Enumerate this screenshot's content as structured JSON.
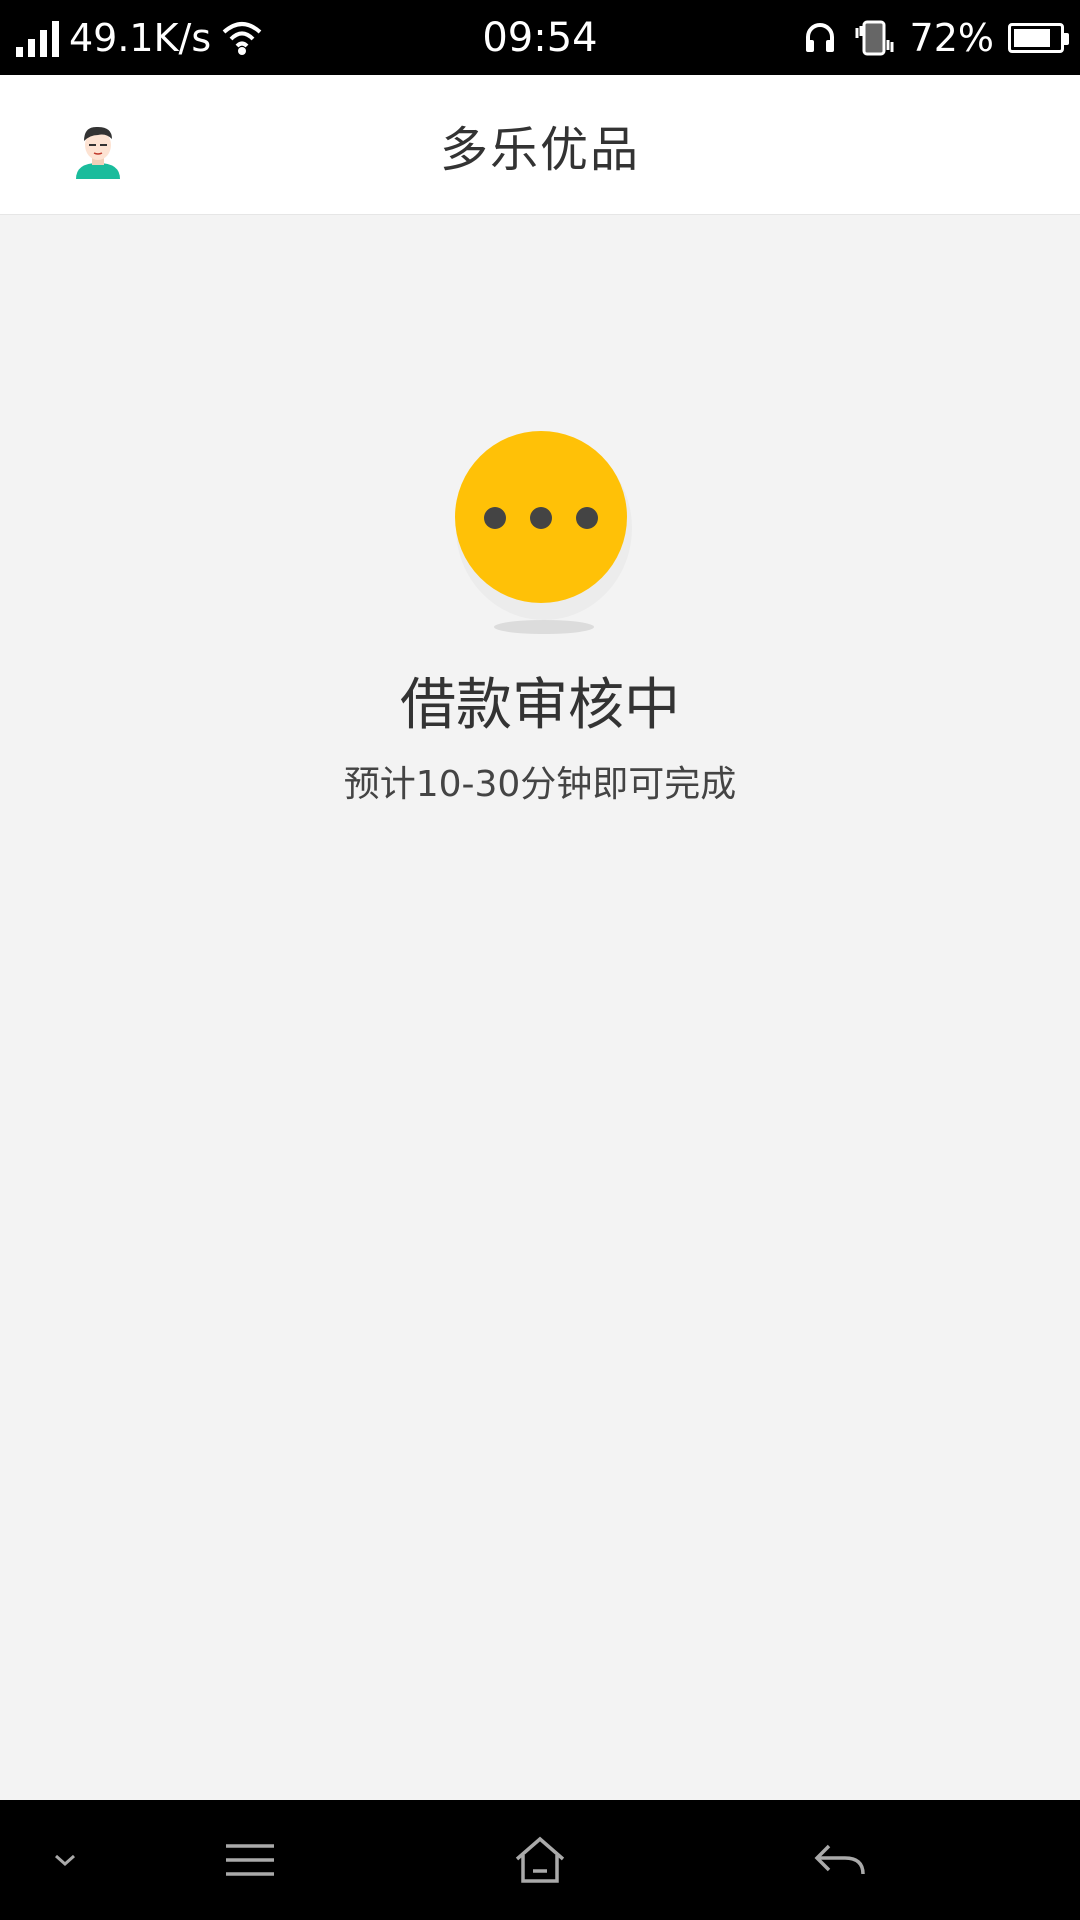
{
  "status_bar": {
    "network_speed": "49.1K/s",
    "time": "09:54",
    "battery_percent": "72%",
    "icons": [
      "signal-icon",
      "wifi-icon",
      "headset-icon",
      "vibrate-icon",
      "battery-icon"
    ]
  },
  "header": {
    "title": "多乐优品",
    "avatar_icon": "user-avatar-icon"
  },
  "status": {
    "icon": "pending-dots-icon",
    "title": "借款审核中",
    "subtitle": "预计10-30分钟即可完成",
    "accent_color": "#FFC107"
  },
  "nav_bar": {
    "buttons": [
      "chevron-down-icon",
      "menu-icon",
      "home-icon",
      "back-icon"
    ]
  }
}
